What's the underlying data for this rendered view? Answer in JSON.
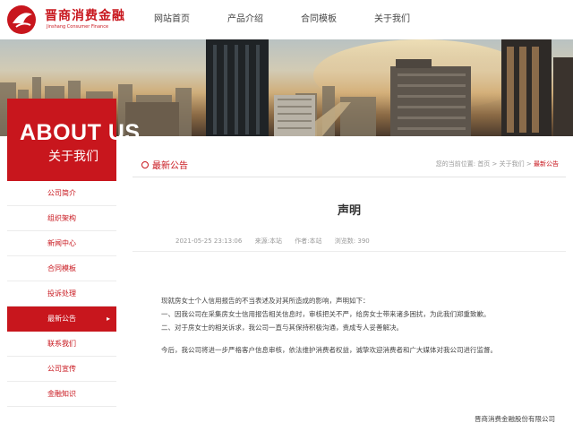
{
  "brand": {
    "name_cn": "晋商消费金融",
    "name_en": "Jinshang Consumer Finance",
    "color": "#c8161d"
  },
  "nav": {
    "items": [
      "网站首页",
      "产品介绍",
      "合同模板",
      "关于我们"
    ]
  },
  "sidebar": {
    "title_en": "ABOUT US",
    "title_cn": "关于我们",
    "items": [
      {
        "label": "公司简介"
      },
      {
        "label": "组织架构"
      },
      {
        "label": "新闻中心"
      },
      {
        "label": "合同模板"
      },
      {
        "label": "投诉处理"
      },
      {
        "label": "最新公告",
        "active": true,
        "arrow": "▸"
      },
      {
        "label": "联系我们"
      },
      {
        "label": "公司宣传"
      },
      {
        "label": "金融知识"
      }
    ]
  },
  "section": {
    "title": "最新公告",
    "breadcrumb": {
      "prefix": "您的当前位置:",
      "items": [
        "首页",
        "关于我们",
        "最新公告"
      ],
      "separator": ">"
    }
  },
  "article": {
    "title": "声明",
    "date": "2021-05-25 23:13:06",
    "source": "来源:本站",
    "author": "作者:本站",
    "views": "浏览数: 390",
    "paragraphs": [
      "现就房女士个人信用报告的不当表述及对其所造成的影响，声明如下：",
      "一、因我公司在采集房女士信用报告相关信息时，审核把关不严，给房女士带来诸多困扰，为此我们郑重致歉。",
      "二、对于房女士的相关诉求，我公司一直与其保持积极沟通，责成专人妥善解决。",
      "今后，我公司将进一步严格客户信息审核，依法维护消费者权益，诚挚欢迎消费者和广大媒体对我公司进行监督。"
    ],
    "signature": "晋商消费金融股份有限公司"
  }
}
